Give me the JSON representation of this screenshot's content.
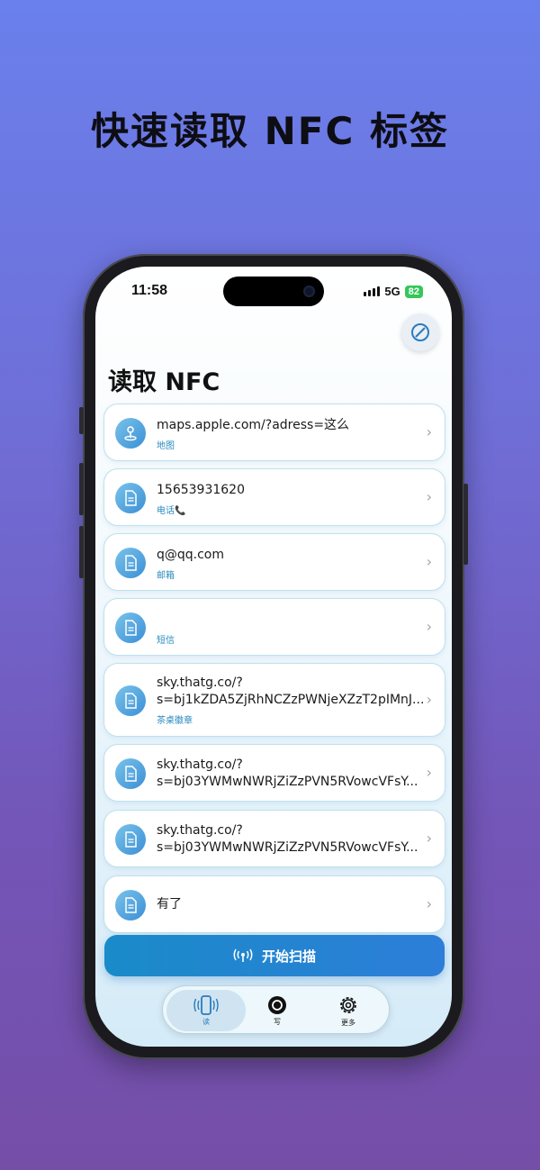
{
  "headline": "快速读取 NFC 标签",
  "status_bar": {
    "time": "11:58",
    "network": "5G",
    "battery": "82"
  },
  "page_title": "读取 NFC",
  "records": [
    {
      "primary": "maps.apple.com/?adress=这么",
      "secondary": "地图",
      "icon": "map-pin-icon"
    },
    {
      "primary": "15653931620",
      "secondary": "电话📞",
      "icon": "document-icon"
    },
    {
      "primary": "q@qq.com",
      "secondary": "邮箱",
      "icon": "document-icon"
    },
    {
      "primary": "",
      "secondary": "短信",
      "icon": "document-icon"
    },
    {
      "primary": "sky.thatg.co/?\ns=bj1kZDA5ZjRhNCZzPWNjeXZzT2pIMnJ...",
      "secondary": "茶桌徽章",
      "icon": "document-icon"
    },
    {
      "primary": "sky.thatg.co/?\ns=bj03YWMwNWRjZiZzPVN5RVowcVFsY...",
      "secondary": "",
      "icon": "document-icon"
    },
    {
      "primary": "sky.thatg.co/?\ns=bj03YWMwNWRjZiZzPVN5RVowcVFsY...",
      "secondary": "",
      "icon": "document-icon"
    },
    {
      "primary": "有了",
      "secondary": "",
      "icon": "document-icon"
    }
  ],
  "scan_button": {
    "label": "开始扫描",
    "icon": "antenna-icon"
  },
  "tabs": [
    {
      "label": "读",
      "icon": "phone-nfc-icon",
      "active": true
    },
    {
      "label": "写",
      "icon": "write-tag-icon",
      "active": false
    },
    {
      "label": "更多",
      "icon": "gear-icon",
      "active": false
    }
  ],
  "colors": {
    "accent": "#2a8bbd",
    "scan_button": "#1a8bc9",
    "battery": "#34c759"
  }
}
